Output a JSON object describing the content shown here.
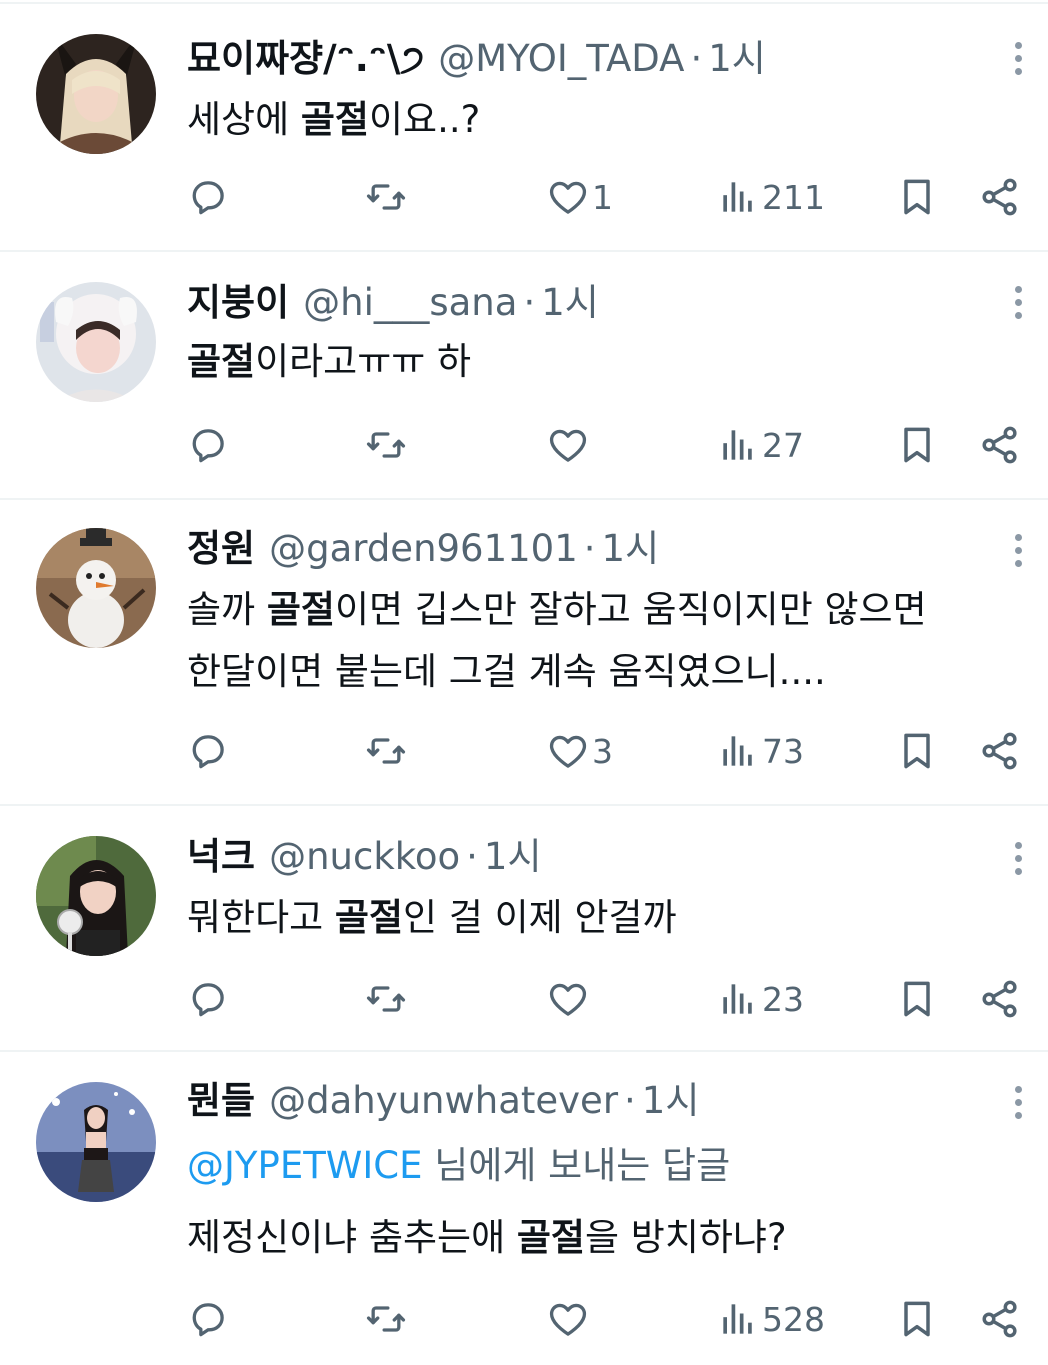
{
  "tweets": [
    {
      "name": "묘이짜쟝/ᵔ.ᵔ\\੭",
      "handle": "@MYOI_TADA",
      "time": "1시",
      "lines": [
        [
          {
            "t": "세상에 ",
            "b": false
          },
          {
            "t": "골절",
            "b": true
          },
          {
            "t": "이요..?",
            "b": false
          }
        ]
      ],
      "likes": "1",
      "views": "211"
    },
    {
      "name": "지붕이",
      "handle": "@hi___sana",
      "time": "1시",
      "lines": [
        [
          {
            "t": "골절",
            "b": true
          },
          {
            "t": "이라고ㅠㅠ 하",
            "b": false
          }
        ]
      ],
      "likes": "",
      "views": "27"
    },
    {
      "name": "정원",
      "handle": "@garden961101",
      "time": "1시",
      "lines": [
        [
          {
            "t": "솔까 ",
            "b": false
          },
          {
            "t": "골절",
            "b": true
          },
          {
            "t": "이면 깁스만 잘하고 움직이지만 않으면",
            "b": false
          }
        ],
        [
          {
            "t": "한달이면 붙는데 그걸 계속 움직였으니....",
            "b": false
          }
        ]
      ],
      "likes": "3",
      "views": "73"
    },
    {
      "name": "넉크",
      "handle": "@nuckkoo",
      "time": "1시",
      "lines": [
        [
          {
            "t": "뭐한다고 ",
            "b": false
          },
          {
            "t": "골절",
            "b": true
          },
          {
            "t": "인 걸 이제 안걸까",
            "b": false
          }
        ]
      ],
      "likes": "",
      "views": "23"
    },
    {
      "name": "뭔들",
      "handle": "@dahyunwhatever",
      "time": "1시",
      "reply_to": "@JYPETWICE",
      "reply_suffix": " 님에게 보내는 답글",
      "lines": [
        [
          {
            "t": "제정신이냐 춤추는애 ",
            "b": false
          },
          {
            "t": "골절",
            "b": true
          },
          {
            "t": "을 방치하냐?",
            "b": false
          }
        ]
      ],
      "likes": "",
      "views": "528"
    }
  ],
  "separator": "·",
  "icons": [
    "reply-icon",
    "retweet-icon",
    "like-icon",
    "views-icon",
    "bookmark-icon",
    "share-icon",
    "more-icon"
  ],
  "colors": {
    "text": "#0f1419",
    "secondary": "#536471",
    "link": "#1d9bf0",
    "divider": "#eff3f4"
  }
}
